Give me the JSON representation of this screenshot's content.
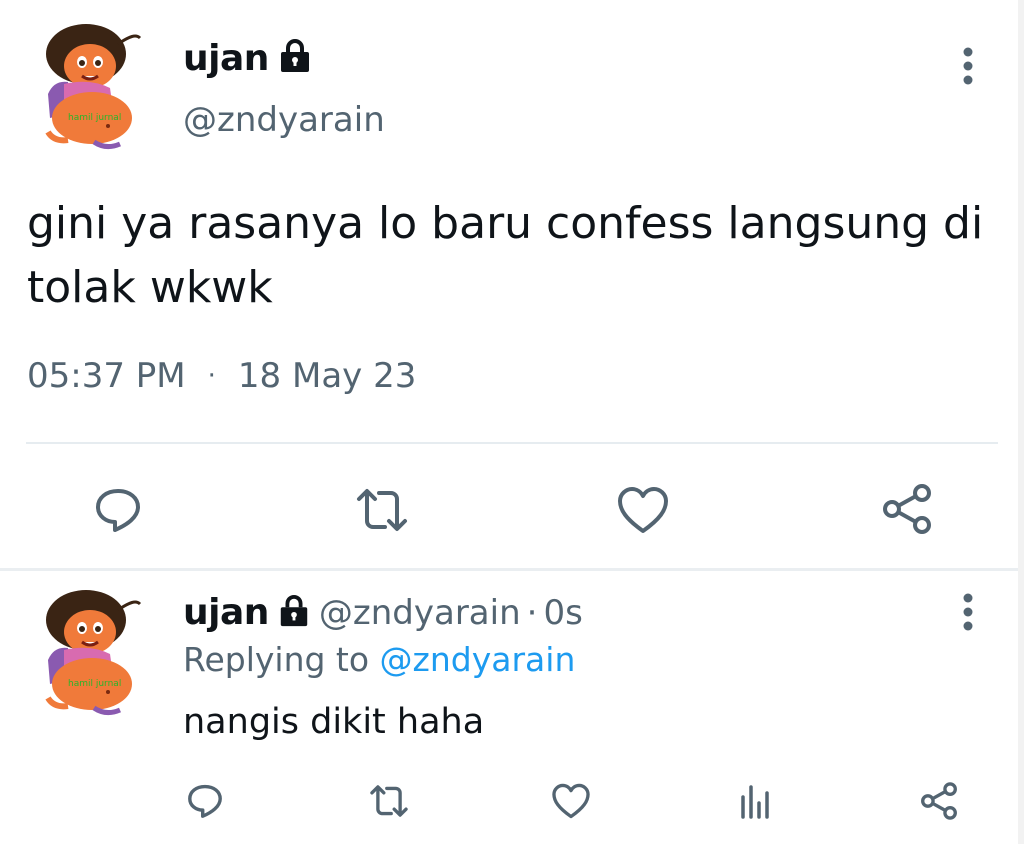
{
  "tweet": {
    "display_name": "ujan",
    "handle": "@zndyarain",
    "text": "gini ya rasanya lo baru confess langsung di tolak wkwk",
    "time": "05:37 PM",
    "separator": "·",
    "date": "18 May 23",
    "avatar_caption": "hamil jurnal",
    "icons": {
      "lock": "lock-icon",
      "more": "more-vertical-icon",
      "reply": "reply-icon",
      "retweet": "retweet-icon",
      "like": "heart-icon",
      "share": "share-icon"
    }
  },
  "reply": {
    "display_name": "ujan",
    "handle": "@zndyarain",
    "separator": "·",
    "time": "0s",
    "replying_prefix": "Replying to",
    "replying_mention": "@zndyarain",
    "text": "nangis dikit haha",
    "avatar_caption": "hamil jurnal",
    "icons": {
      "reply": "reply-icon",
      "retweet": "retweet-icon",
      "like": "heart-icon",
      "analytics": "analytics-icon",
      "share": "share-icon"
    }
  },
  "colors": {
    "text": "#0f1419",
    "secondary": "#536471",
    "link": "#1d9bf0",
    "icon": "#536471",
    "divider": "#e6ecf0"
  }
}
